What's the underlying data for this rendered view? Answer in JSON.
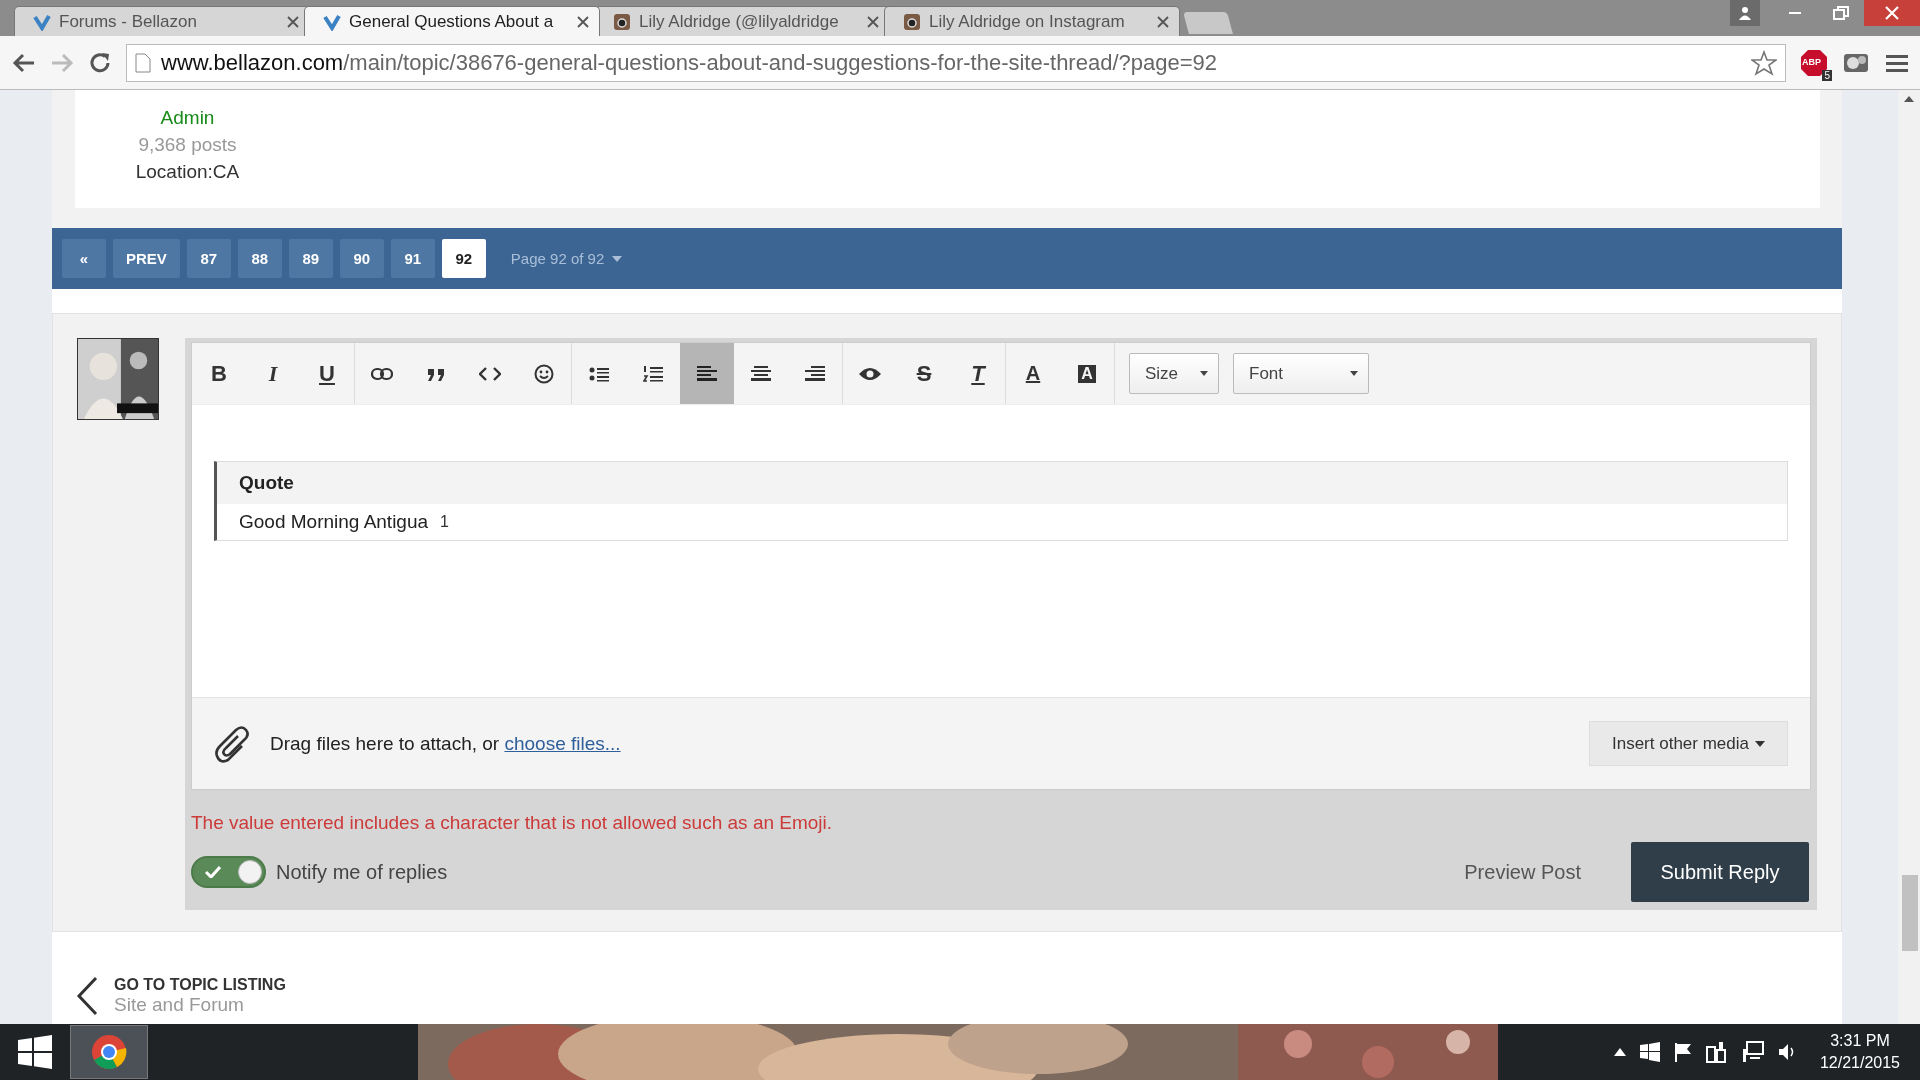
{
  "browser": {
    "tabs": [
      {
        "title": "Forums - Bellazon",
        "kind": "forum",
        "selected": false
      },
      {
        "title": "General Questions About a",
        "kind": "forum",
        "selected": true
      },
      {
        "title": "Lily Aldridge (@lilyaldridge",
        "selected": false
      },
      {
        "title": "Lily Aldridge on Instagram",
        "selected": false
      }
    ],
    "url_host": "www.bellazon.com",
    "url_path": "/main/topic/38676-general-questions-about-and-suggestions-for-the-site-thread/?page=92",
    "adblock_badge": "5",
    "adblock_label": "ABP"
  },
  "author": {
    "group": "Admin",
    "posts": "9,368 posts",
    "location": "Location:CA"
  },
  "pagination": {
    "first": "«",
    "prev": "PREV",
    "pages": [
      {
        "label": "87",
        "selected": false
      },
      {
        "label": "88",
        "selected": false
      },
      {
        "label": "89",
        "selected": false
      },
      {
        "label": "90",
        "selected": false
      },
      {
        "label": "91",
        "selected": false
      },
      {
        "label": "92",
        "selected": true
      }
    ],
    "jump": "Page 92 of 92"
  },
  "editor": {
    "toolbar": [
      [
        {
          "kind": "bold",
          "text": "B",
          "selected": false
        },
        {
          "kind": "italic",
          "text": "I",
          "selected": false
        },
        {
          "kind": "underline",
          "text": "U",
          "selected": false
        }
      ],
      [
        {
          "kind": "link",
          "selected": false
        },
        {
          "kind": "quote",
          "selected": false
        },
        {
          "kind": "code",
          "selected": false
        },
        {
          "kind": "emoji",
          "selected": false
        }
      ],
      [
        {
          "kind": "bullets",
          "selected": false
        },
        {
          "kind": "numbers",
          "selected": false
        },
        {
          "kind": "align-left",
          "selected": true
        },
        {
          "kind": "align-center",
          "selected": false
        },
        {
          "kind": "align-right",
          "selected": false
        }
      ],
      [
        {
          "kind": "preview",
          "selected": false
        },
        {
          "kind": "strike",
          "text": "S",
          "selected": false
        },
        {
          "kind": "clear",
          "text": "T",
          "selected": false
        }
      ],
      [
        {
          "kind": "text-color",
          "text": "A",
          "selected": false
        },
        {
          "kind": "bg-color",
          "text": "A",
          "selected": false
        }
      ]
    ],
    "dropdowns": [
      "Size",
      "Font"
    ],
    "quote": {
      "title": "Quote",
      "text": "Good Morning Antigua",
      "mark": "1"
    },
    "attach_text": "Drag files here to attach, or ",
    "attach_link": "choose files...",
    "insert_media": "Insert other media"
  },
  "error": "The value entered includes a character that is not allowed such as an Emoji.",
  "notify": {
    "label": "Notify me of replies",
    "on": true
  },
  "preview_button": "Preview Post",
  "submit_button": "Submit Reply",
  "topic_link": {
    "title": "GO TO TOPIC LISTING",
    "subtitle": "Site and Forum"
  },
  "taskbar": {
    "time": "3:31 PM",
    "date": "12/21/2015"
  }
}
